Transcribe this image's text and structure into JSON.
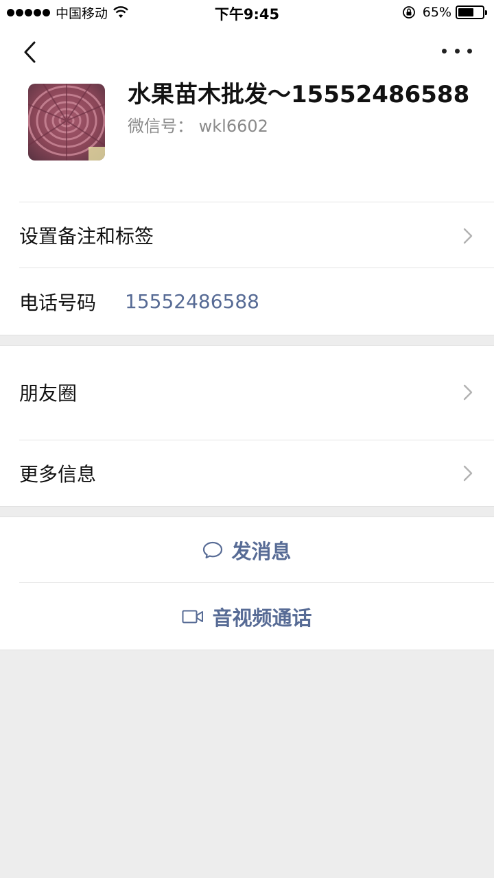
{
  "status_bar": {
    "carrier": "中国移动",
    "time": "下午9:45",
    "battery_percent": "65%",
    "battery_level": 0.65,
    "icons": [
      "signal-dots-icon",
      "wifi-icon",
      "rotation-lock-icon",
      "battery-icon"
    ]
  },
  "nav": {
    "back_icon": "chevron-left-icon",
    "more_icon": "ellipsis-icon"
  },
  "profile": {
    "name": "水果苗木批发～15552486588",
    "wechat_id": "微信号： wkl6602",
    "avatar": "succulent-photo"
  },
  "rows": {
    "remark_label": "设置备注和标签",
    "phone_label": "电话号码",
    "phone_value": "15552486588",
    "moments_label": "朋友圈",
    "more_info_label": "更多信息"
  },
  "actions": {
    "message_label": "发消息",
    "message_icon": "chat-bubble-icon",
    "call_label": "音视频通话",
    "call_icon": "video-camera-icon"
  },
  "colors": {
    "link": "#576b95",
    "background": "#ededed",
    "card": "#ffffff"
  }
}
